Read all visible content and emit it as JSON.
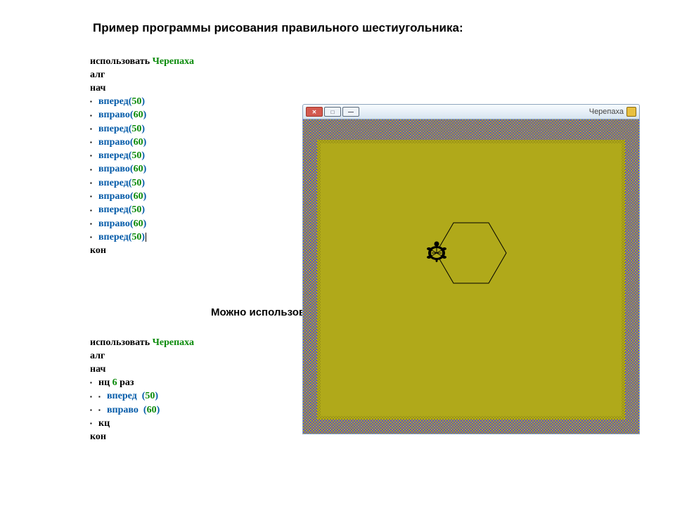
{
  "title": "Пример программы рисования правильного шестиугольника:",
  "subtitle": "Можно использовать к",
  "code1": {
    "use": "использовать",
    "module": "Черепаха",
    "alg": "алг",
    "begin": "нач",
    "cmds": [
      {
        "name": "вперед",
        "arg": "50"
      },
      {
        "name": "вправо",
        "arg": "60"
      },
      {
        "name": "вперед",
        "arg": "50"
      },
      {
        "name": "вправо",
        "arg": "60"
      },
      {
        "name": "вперед",
        "arg": "50"
      },
      {
        "name": "вправо",
        "arg": "60"
      },
      {
        "name": "вперед",
        "arg": "50"
      },
      {
        "name": "вправо",
        "arg": "60"
      },
      {
        "name": "вперед",
        "arg": "50"
      },
      {
        "name": "вправо",
        "arg": "60"
      },
      {
        "name": "вперед",
        "arg": "50"
      }
    ],
    "end": "кон"
  },
  "code2": {
    "use": "использовать",
    "module": "Черепаха",
    "alg": "алг",
    "begin": "нач",
    "loop_kw": "нц",
    "loop_count": "6",
    "loop_unit": "раз",
    "body": [
      {
        "name": "вперед",
        "arg": "50"
      },
      {
        "name": "вправо",
        "arg": "60"
      }
    ],
    "loop_end": "кц",
    "end": "кон"
  },
  "window": {
    "title": "Черепаха"
  }
}
